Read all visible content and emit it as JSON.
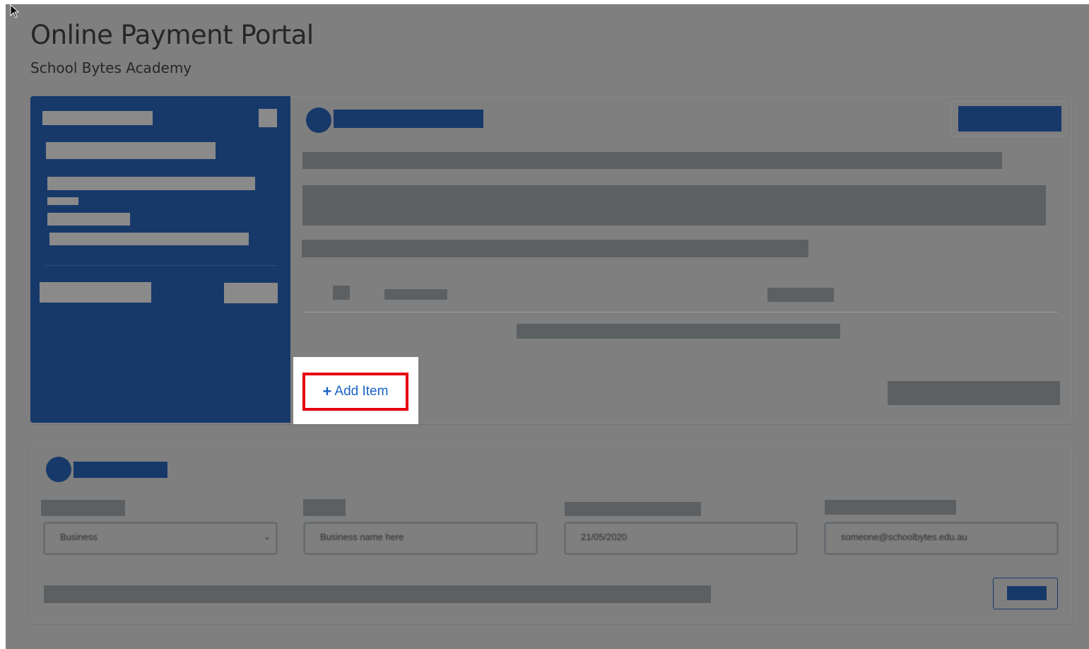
{
  "header": {
    "title": "Online Payment Portal",
    "subtitle": "School Bytes Academy"
  },
  "cart": {
    "add_item_label": "Add Item"
  },
  "details": {
    "fields": [
      {
        "value": "Business"
      },
      {
        "value": "Business name here"
      },
      {
        "value": "21/05/2020"
      },
      {
        "value": "someone@schoolbytes.edu.au"
      }
    ]
  },
  "colors": {
    "overlay": "#7f7f7f",
    "navy": "#17396a",
    "highlight": "#e6000f",
    "link": "#1a63c6"
  },
  "icons": {
    "cursor": "cursor-arrow-icon",
    "add": "plus-icon",
    "select_chevron": "chevron-down-icon"
  }
}
